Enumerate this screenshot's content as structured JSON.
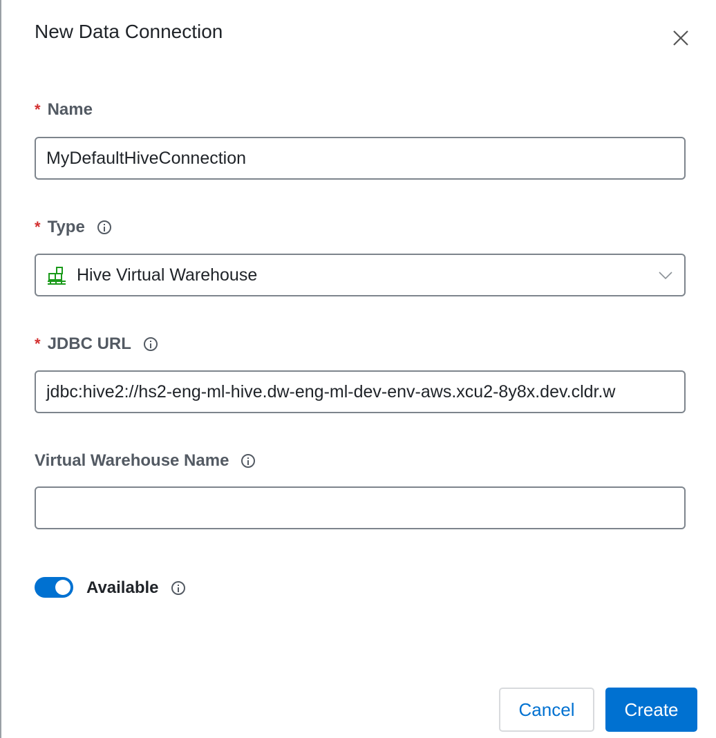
{
  "dialog": {
    "title": "New Data Connection"
  },
  "fields": {
    "name": {
      "label": "Name",
      "required": "*",
      "value": "MyDefaultHiveConnection"
    },
    "type": {
      "label": "Type",
      "required": "*",
      "value": "Hive Virtual Warehouse"
    },
    "jdbc": {
      "label": "JDBC URL",
      "required": "*",
      "value": "jdbc:hive2://hs2-eng-ml-hive.dw-eng-ml-dev-env-aws.xcu2-8y8x.dev.cldr.w"
    },
    "warehouse": {
      "label": "Virtual Warehouse Name",
      "value": ""
    },
    "available": {
      "label": "Available",
      "on": true
    }
  },
  "buttons": {
    "cancel": "Cancel",
    "create": "Create"
  },
  "colors": {
    "primary": "#0071d1",
    "required": "#d32f2f",
    "icon_green": "#1a9a1a"
  }
}
